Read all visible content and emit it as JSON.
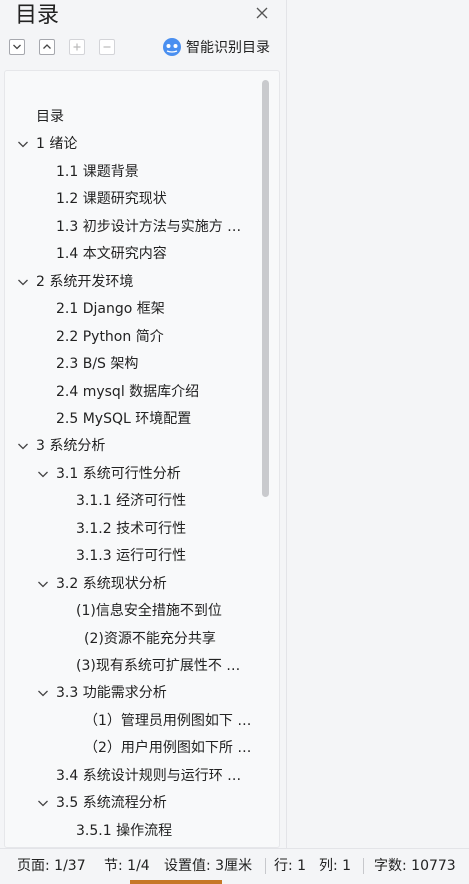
{
  "panel": {
    "title": "目录",
    "smart_toc_label": "智能识别目录"
  },
  "toc": [
    {
      "text": "目录",
      "level": 0,
      "expanded": null
    },
    {
      "text": "1  绪论",
      "level": 0,
      "expanded": true
    },
    {
      "text": "1.1  课题背景",
      "level": 1,
      "expanded": null
    },
    {
      "text": "1.2  课题研究现状",
      "level": 1,
      "expanded": null
    },
    {
      "text": "1.3  初步设计方法与实施方 …",
      "level": 1,
      "expanded": null
    },
    {
      "text": "1.4  本文研究内容",
      "level": 1,
      "expanded": null
    },
    {
      "text": "2  系统开发环境",
      "level": 0,
      "expanded": true
    },
    {
      "text": "2.1 Django 框架",
      "level": 1,
      "expanded": null
    },
    {
      "text": "2.2 Python 简介",
      "level": 1,
      "expanded": null
    },
    {
      "text": "2.3 B/S 架构",
      "level": 1,
      "expanded": null
    },
    {
      "text": "2.4 mysql 数据库介绍",
      "level": 1,
      "expanded": null
    },
    {
      "text": "2.5 MySQL 环境配置",
      "level": 1,
      "expanded": null
    },
    {
      "text": "3  系统分析",
      "level": 0,
      "expanded": true
    },
    {
      "text": "3.1  系统可行性分析",
      "level": 1,
      "expanded": true
    },
    {
      "text": "3.1.1  经济可行性",
      "level": 2,
      "expanded": null
    },
    {
      "text": "3.1.2  技术可行性",
      "level": 2,
      "expanded": null
    },
    {
      "text": "3.1.3  运行可行性",
      "level": 2,
      "expanded": null
    },
    {
      "text": "3.2  系统现状分析",
      "level": 1,
      "expanded": true
    },
    {
      "text": "(1)信息安全措施不到位",
      "level": 2,
      "expanded": null
    },
    {
      "text": "(2)资源不能充分共享",
      "level": 2.4,
      "expanded": null
    },
    {
      "text": "(3)现有系统可扩展性不 …",
      "level": 2,
      "expanded": null
    },
    {
      "text": "3.3  功能需求分析",
      "level": 1,
      "expanded": true
    },
    {
      "text": "（1）管理员用例图如下 …",
      "level": 2.4,
      "expanded": null
    },
    {
      "text": "（2）用户用例图如下所 …",
      "level": 2.4,
      "expanded": null
    },
    {
      "text": "3.4  系统设计规则与运行环 …",
      "level": 1,
      "expanded": null
    },
    {
      "text": "3.5 系统流程分析",
      "level": 1,
      "expanded": true
    },
    {
      "text": "3.5.1 操作流程",
      "level": 2,
      "expanded": null
    }
  ],
  "status": {
    "page": "页面: 1/37",
    "section": "节: 1/4",
    "setting": "设置值: 3厘米",
    "row": "行: 1",
    "col": "列: 1",
    "words": "字数: 10773"
  }
}
